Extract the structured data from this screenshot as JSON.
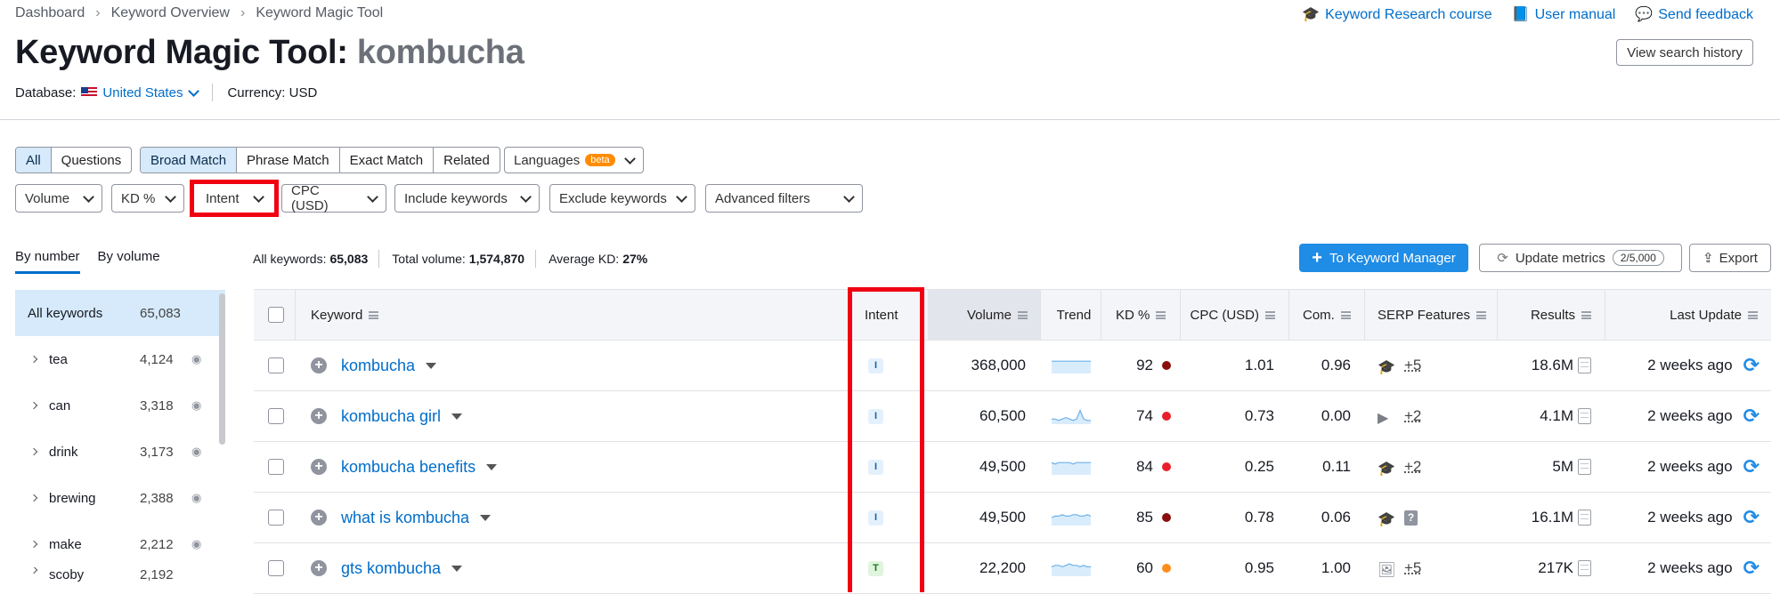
{
  "breadcrumbs": [
    "Dashboard",
    "Keyword Overview",
    "Keyword Magic Tool"
  ],
  "title": {
    "tool": "Keyword Magic Tool:",
    "query": "kombucha"
  },
  "database": {
    "label": "Database:",
    "value": "United States",
    "currency": "Currency: USD"
  },
  "toplinks": {
    "course": "Keyword Research course",
    "manual": "User manual",
    "feedback": "Send feedback"
  },
  "view_history": "View search history",
  "segments": {
    "all": "All",
    "questions": "Questions",
    "broad": "Broad Match",
    "phrase": "Phrase Match",
    "exact": "Exact Match",
    "related": "Related",
    "languages": "Languages",
    "beta": "beta"
  },
  "filters": {
    "volume": "Volume",
    "kd": "KD %",
    "intent": "Intent",
    "cpc": "CPC (USD)",
    "include": "Include keywords",
    "exclude": "Exclude keywords",
    "advanced": "Advanced filters"
  },
  "tabs": {
    "by_number": "By number",
    "by_volume": "By volume"
  },
  "stats": {
    "all_label": "All keywords:",
    "all_value": "65,083",
    "vol_label": "Total volume:",
    "vol_value": "1,574,870",
    "kd_label": "Average KD:",
    "kd_value": "27%"
  },
  "actions": {
    "to_manager": "To Keyword Manager",
    "update": "Update metrics",
    "update_count": "2/5,000",
    "export": "Export"
  },
  "sidebar": [
    {
      "label": "All keywords",
      "count": "65,083"
    },
    {
      "label": "tea",
      "count": "4,124"
    },
    {
      "label": "can",
      "count": "3,318"
    },
    {
      "label": "drink",
      "count": "3,173"
    },
    {
      "label": "brewing",
      "count": "2,388"
    },
    {
      "label": "make",
      "count": "2,212"
    },
    {
      "label": "scoby",
      "count": "2,192"
    }
  ],
  "columns": {
    "keyword": "Keyword",
    "intent": "Intent",
    "volume": "Volume",
    "trend": "Trend",
    "kd": "KD %",
    "cpc": "CPC (USD)",
    "com": "Com.",
    "serp": "SERP Features",
    "results": "Results",
    "update": "Last Update"
  },
  "rows": [
    {
      "keyword": "kombucha",
      "intent": "I",
      "volume": "368,000",
      "kd": "92",
      "kd_color": "#8b0e0e",
      "cpc": "1.01",
      "com": "0.96",
      "serp_icon": "graduation-cap-icon",
      "serp_more": "+5",
      "results": "18.6M",
      "update": "2 weeks ago",
      "trend": [
        8,
        8,
        8,
        8,
        8,
        8,
        8,
        8,
        8,
        8,
        8,
        8
      ]
    },
    {
      "keyword": "kombucha girl",
      "intent": "I",
      "volume": "60,500",
      "kd": "74",
      "kd_color": "#e8202a",
      "cpc": "0.73",
      "com": "0.00",
      "serp_icon": "video-icon",
      "serp_more": "+2",
      "results": "4.1M",
      "update": "2 weeks ago",
      "trend": [
        3,
        3,
        2,
        3,
        4,
        3,
        2,
        3,
        9,
        3,
        2,
        2
      ]
    },
    {
      "keyword": "kombucha benefits",
      "intent": "I",
      "volume": "49,500",
      "kd": "84",
      "kd_color": "#e8202a",
      "cpc": "0.25",
      "com": "0.11",
      "serp_icon": "graduation-cap-icon",
      "serp_more": "+2",
      "results": "5M",
      "update": "2 weeks ago",
      "trend": [
        8,
        7,
        8,
        8,
        8,
        8,
        7,
        8,
        8,
        8,
        8,
        8
      ]
    },
    {
      "keyword": "what is kombucha",
      "intent": "I",
      "volume": "49,500",
      "kd": "85",
      "kd_color": "#8b0e0e",
      "cpc": "0.78",
      "com": "0.06",
      "serp_icon": "graduation-cap-icon",
      "serp_more": "?",
      "results": "16.1M",
      "update": "2 weeks ago",
      "trend": [
        5,
        6,
        6,
        7,
        6,
        6,
        7,
        7,
        6,
        6,
        7,
        6
      ]
    },
    {
      "keyword": "gts kombucha",
      "intent": "T",
      "volume": "22,200",
      "kd": "60",
      "kd_color": "#ff8c1a",
      "cpc": "0.95",
      "com": "1.00",
      "serp_icon": "image-icon",
      "serp_more": "+5",
      "results": "217K",
      "update": "2 weeks ago",
      "trend": [
        6,
        7,
        7,
        6,
        7,
        8,
        7,
        7,
        6,
        7,
        6,
        6
      ]
    }
  ]
}
